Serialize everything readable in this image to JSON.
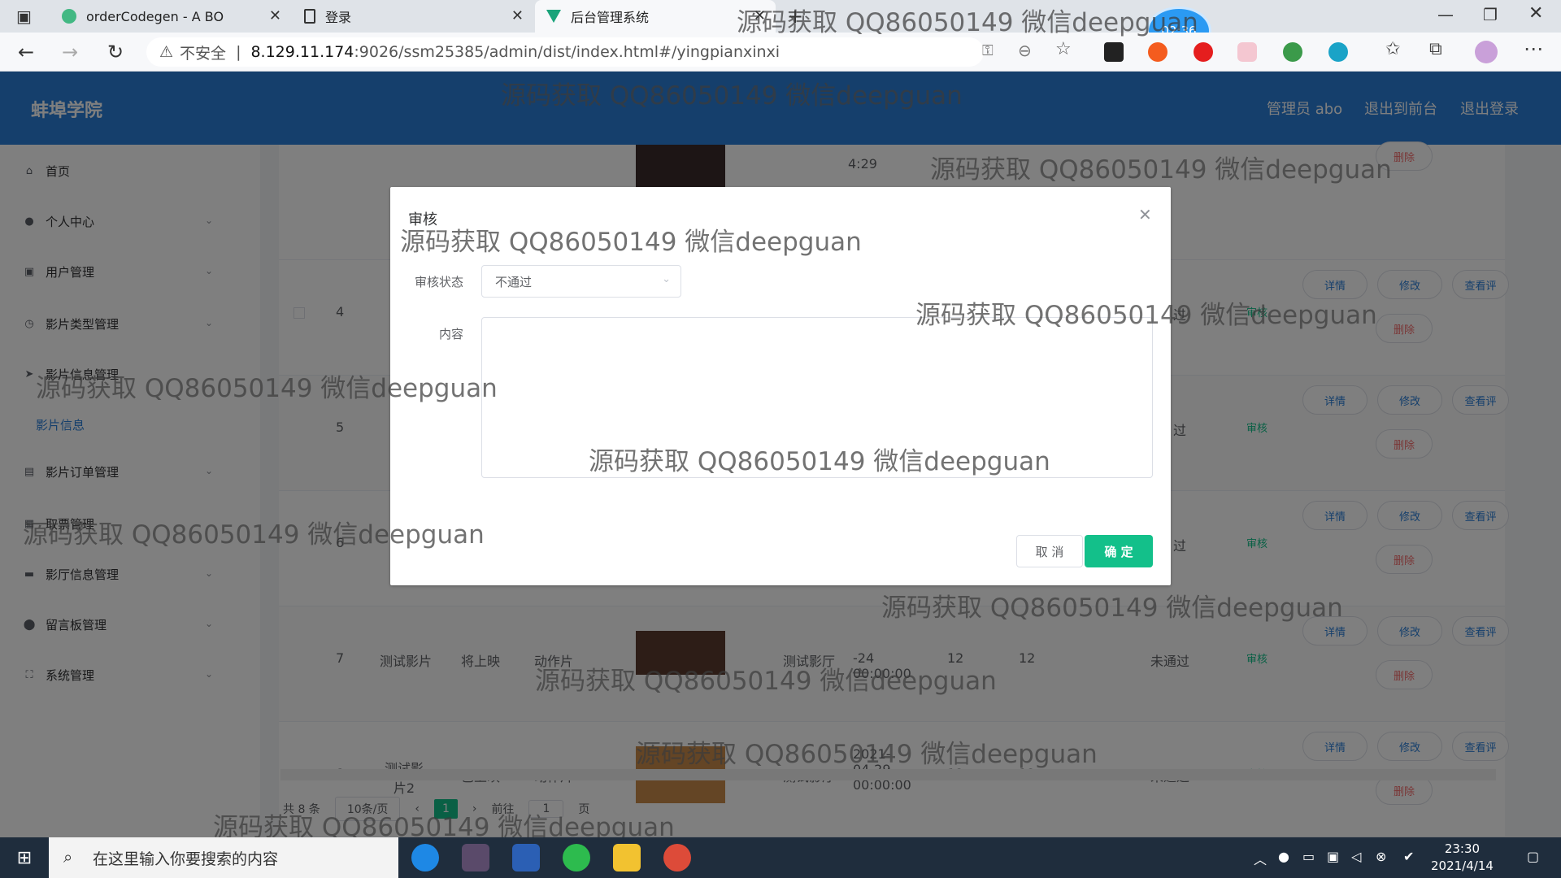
{
  "browser": {
    "tabs": [
      {
        "title": "orderCodegen - A BO"
      },
      {
        "title": "登录"
      },
      {
        "title": "后台管理系统"
      }
    ],
    "address_prefix": "不安全",
    "url_host": "8.129.11.174",
    "url_rest": ":9026/ssm25385/admin/dist/index.html#/yingpianxinxi",
    "timer_badge": "02:36"
  },
  "header": {
    "brand": "蚌埠学院",
    "links": [
      "管理员 abo",
      "退出到前台",
      "退出登录"
    ]
  },
  "sidebar": {
    "items": [
      {
        "label": "首页"
      },
      {
        "label": "个人中心"
      },
      {
        "label": "用户管理"
      },
      {
        "label": "影片类型管理"
      },
      {
        "label": "影片信息管理"
      },
      {
        "label": "影片信息"
      },
      {
        "label": "影片订单管理"
      },
      {
        "label": "取票管理"
      },
      {
        "label": "影厅信息管理"
      },
      {
        "label": "留言板管理"
      },
      {
        "label": "系统管理"
      }
    ]
  },
  "table": {
    "top_time": "4:29",
    "rows": [
      {
        "index": "4",
        "status": "过",
        "audit": "审核"
      },
      {
        "index": "5",
        "status": "过",
        "audit": "审核"
      },
      {
        "index": "6",
        "status": "过",
        "audit": "审核"
      },
      {
        "index": "7",
        "name": "测试影片",
        "state": "将上映",
        "type": "动作片",
        "hall": "测试影厅",
        "time": "-24 00:00:00",
        "a": "12",
        "b": "12",
        "status": "未通过",
        "audit": "审核"
      },
      {
        "index": "8",
        "name": "测试影片2",
        "state": "已上映",
        "type": "动作片",
        "hall": "测试影厅",
        "time": "2021-04-29 00:00:00",
        "a": "12",
        "b": "12",
        "status": "未通过",
        "audit": "审核"
      }
    ],
    "actions": {
      "detail": "详情",
      "edit": "修改",
      "comments": "查看评",
      "delete": "删除"
    }
  },
  "pager": {
    "total": "共 8 条",
    "page_size": "10条/页",
    "current": "1",
    "goto_label": "前往",
    "goto_value": "1",
    "page_unit": "页"
  },
  "dialog": {
    "title": "审核",
    "status_label": "审核状态",
    "status_value": "不通过",
    "content_label": "内容",
    "content_value": "",
    "cancel": "取 消",
    "ok": "确 定"
  },
  "watermark": "源码获取 QQ86050149 微信deepguan",
  "taskbar": {
    "search_placeholder": "在这里输入你要搜索的内容",
    "time": "23:30",
    "date": "2021/4/14"
  },
  "colors": {
    "primary": "#2a7fd8",
    "confirm": "#13c08a",
    "danger": "#f56c6c"
  }
}
